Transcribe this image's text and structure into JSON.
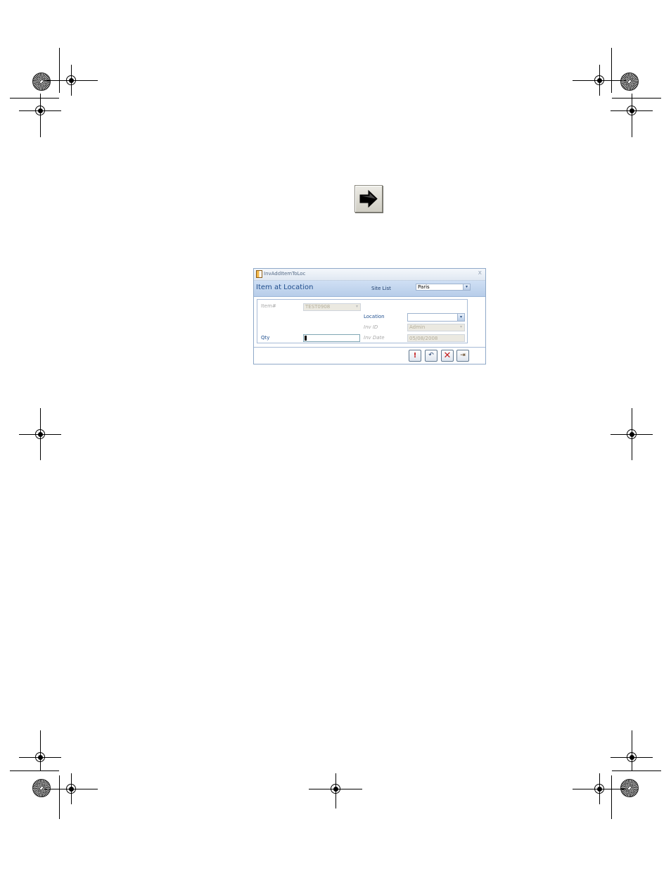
{
  "window": {
    "title": "InvAddItemToLoc",
    "close_glyph": "x",
    "header_title": "Item at Location",
    "site_list": {
      "label": "Site List",
      "value": "Paris"
    }
  },
  "fields": {
    "item": {
      "label": "Item#",
      "value": "TEST0908"
    },
    "location": {
      "label": "Location",
      "value": ""
    },
    "inv_id": {
      "label": "Inv ID",
      "value": "Admin"
    },
    "qty": {
      "label": "Qty",
      "value": ""
    },
    "inv_date": {
      "label": "Inv Date",
      "value": "05/08/2008"
    }
  },
  "buttons": {
    "run_glyph": "!",
    "undo_glyph": "↶",
    "delete_glyph": "✕",
    "exit_glyph": "⇥"
  },
  "icons": {
    "arrow": "right-arrow-icon",
    "run": "exclamation-icon",
    "undo": "undo-icon",
    "delete": "delete-x-icon",
    "exit": "exit-door-icon",
    "form": "form-icon"
  },
  "colors": {
    "header_band": "#c3d6ef",
    "label_enabled": "#1f4f8f",
    "label_disabled": "#a8a8a8",
    "delete_red": "#c41e1e"
  }
}
